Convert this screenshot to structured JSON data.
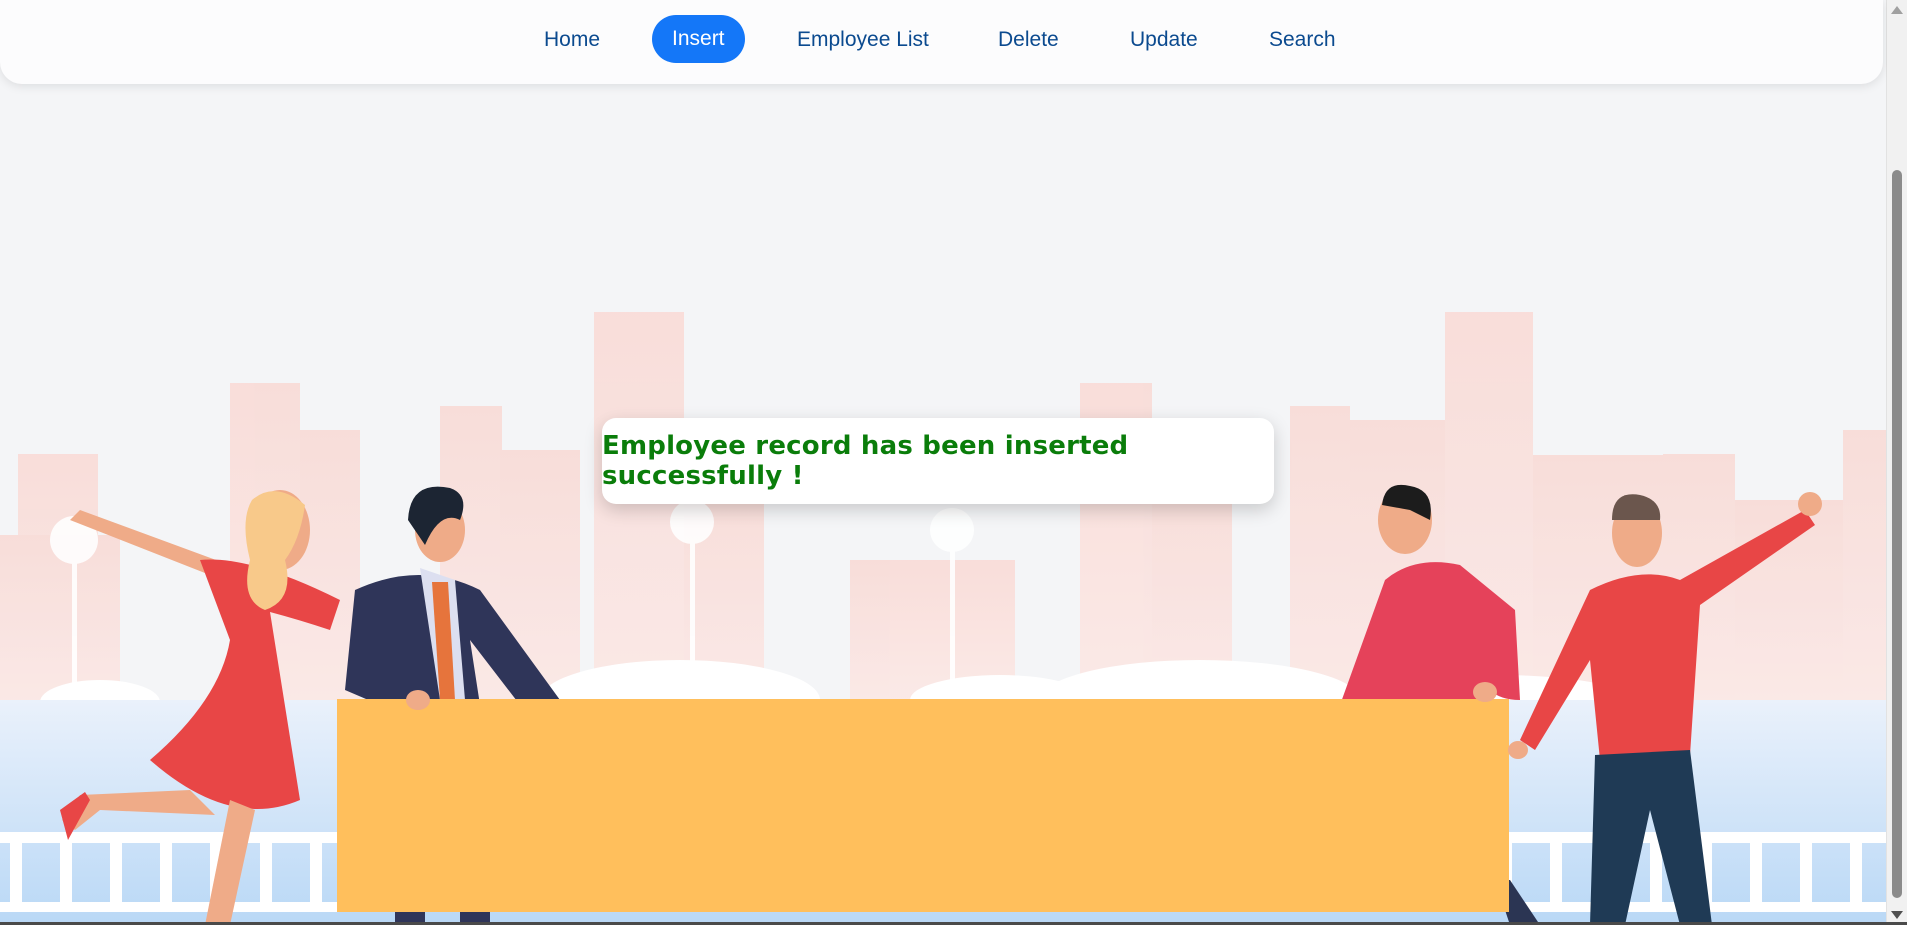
{
  "nav": {
    "items": [
      {
        "label": "Home",
        "active": false
      },
      {
        "label": "Insert",
        "active": true
      },
      {
        "label": "Employee List",
        "active": false
      },
      {
        "label": "Delete",
        "active": false
      },
      {
        "label": "Update",
        "active": false
      },
      {
        "label": "Search",
        "active": false
      }
    ]
  },
  "message": {
    "text": "Employee record has been inserted successfully !"
  },
  "colors": {
    "nav_active": "#1477f8",
    "nav_text": "#0b4a8f",
    "message_text": "#0a7d0a",
    "banner": "#ffbf5c"
  },
  "illustration": {
    "name": "team-celebration-illustration"
  }
}
